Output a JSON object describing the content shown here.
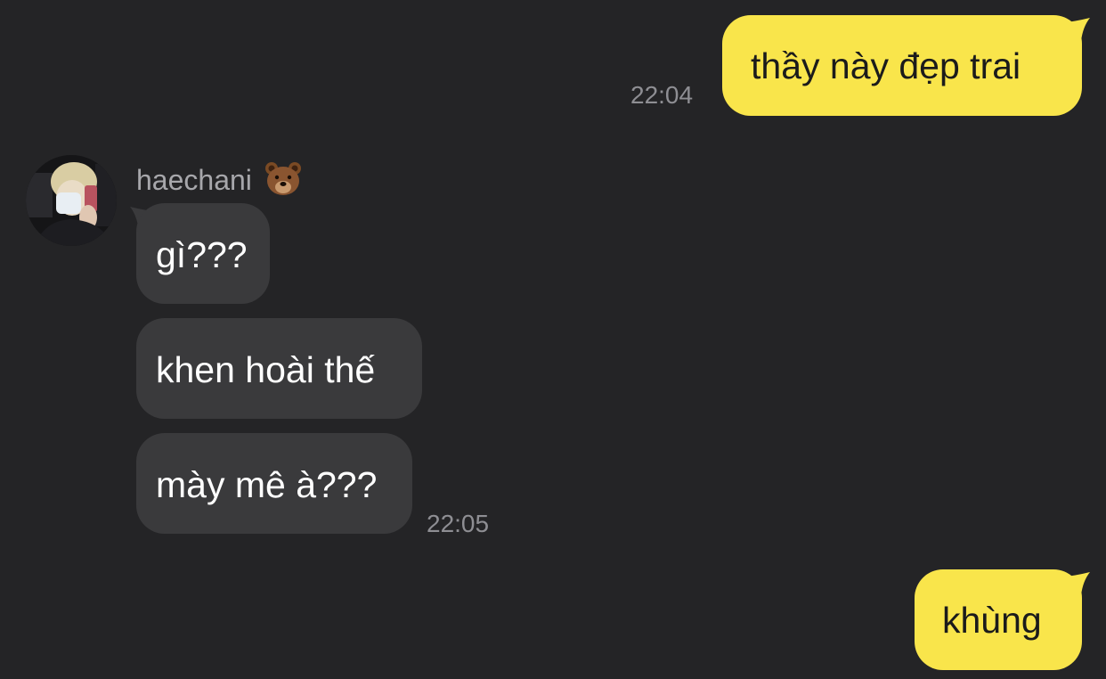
{
  "colors": {
    "background": "#242426",
    "outgoing_bubble": "#f9e54b",
    "incoming_bubble": "#3a3a3c",
    "timestamp": "#8e8e93"
  },
  "messages": [
    {
      "direction": "outgoing",
      "text": "thầy này đẹp trai",
      "time": "22:04"
    },
    {
      "direction": "incoming",
      "text": "gì???"
    },
    {
      "direction": "incoming",
      "text": "khen hoài thế"
    },
    {
      "direction": "incoming",
      "text": "mày mê à???",
      "time": "22:05"
    },
    {
      "direction": "outgoing",
      "text": "khùng"
    }
  ],
  "sender": {
    "name": "haechani",
    "emoji_icon": "bear-face-icon"
  }
}
